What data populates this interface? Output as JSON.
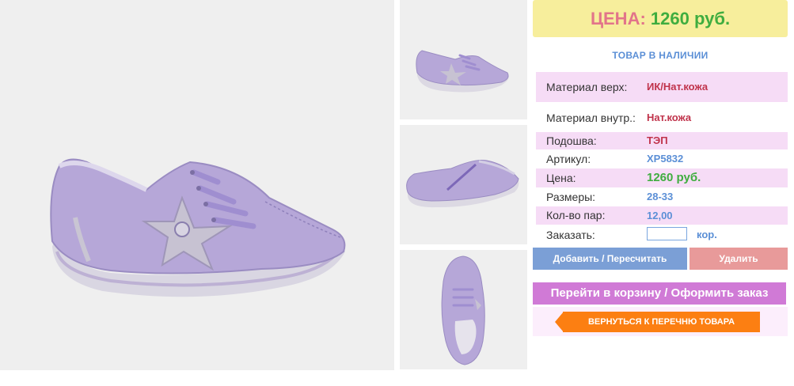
{
  "price": {
    "label": "ЦЕНА:",
    "value": "1260 руб."
  },
  "stock_status": "ТОВАР В НАЛИЧИИ",
  "specs": [
    {
      "key": "Материал верх:",
      "value": "ИК/Нат.кожа"
    },
    {
      "key": "Материал внутр.:",
      "value": "Нат.кожа"
    },
    {
      "key": "Подошва:",
      "value": "ТЭП"
    },
    {
      "key": "Артикул:",
      "value": "XP5832"
    },
    {
      "key": "Цена:",
      "value": "1260 руб."
    },
    {
      "key": "Размеры:",
      "value": "28-33"
    },
    {
      "key": "Кол-во пар:",
      "value": "12,00"
    }
  ],
  "order": {
    "label": "Заказать:",
    "value": "",
    "unit": "кор."
  },
  "buttons": {
    "add": "Добавить / Пересчитать",
    "delete": "Удалить",
    "cart": "Перейти в корзину / Оформить заказ",
    "back": "ВЕРНУТЬСЯ К ПЕРЕЧНЮ ТОВАРА"
  },
  "colors": {
    "price_bg": "#f7ee9c",
    "price_label": "#e2748a",
    "price_value": "#3fad3f",
    "accent_blue": "#5b8fd6",
    "row_pink": "#f6dcf6",
    "btn_add": "#7b9fd6",
    "btn_delete": "#e89a9a",
    "btn_cart": "#d07ad6",
    "btn_back": "#fc7f12"
  }
}
